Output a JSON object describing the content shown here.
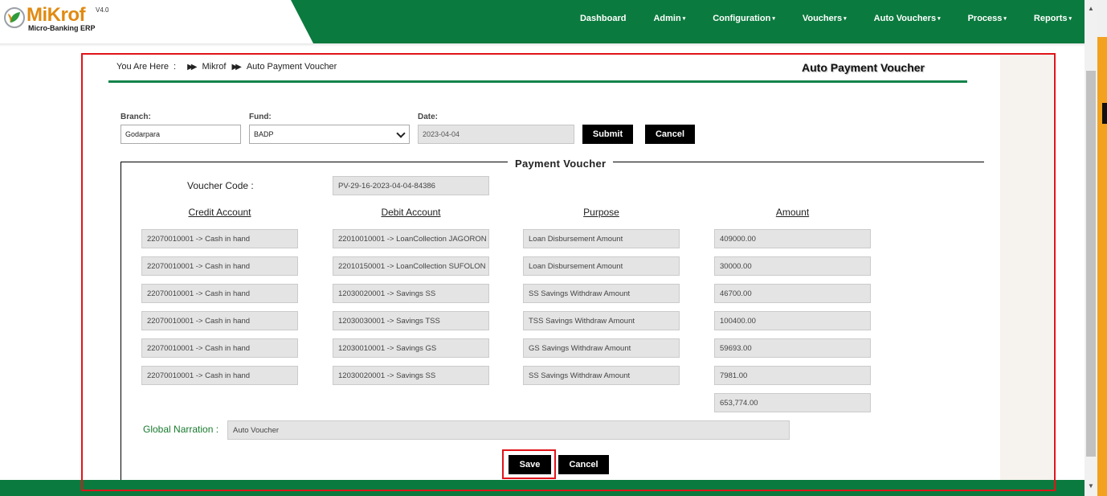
{
  "app": {
    "logo_name": "MiKrof",
    "logo_version": "V4.0",
    "logo_subtitle": "Micro-Banking ERP"
  },
  "nav": [
    {
      "label": "Dashboard",
      "dropdown": false
    },
    {
      "label": "Admin",
      "dropdown": true
    },
    {
      "label": "Configuration",
      "dropdown": true
    },
    {
      "label": "Vouchers",
      "dropdown": true
    },
    {
      "label": "Auto Vouchers",
      "dropdown": true
    },
    {
      "label": "Process",
      "dropdown": true
    },
    {
      "label": "Reports",
      "dropdown": true
    }
  ],
  "breadcrumb": {
    "prefix": "You Are Here",
    "colon": ":",
    "items": [
      "Mikrof",
      "Auto Payment Voucher"
    ]
  },
  "page_title": "Auto Payment Voucher",
  "filters": {
    "branch_label": "Branch:",
    "branch_value": "Godarpara",
    "fund_label": "Fund:",
    "fund_value": "BADP",
    "date_label": "Date:",
    "date_value": "2023-04-04",
    "submit_label": "Submit",
    "cancel_label": "Cancel"
  },
  "voucher": {
    "legend": "Payment Voucher",
    "code_label": "Voucher Code :",
    "code_value": "PV-29-16-2023-04-04-84386",
    "columns": [
      "Credit Account",
      "Debit Account",
      "Purpose",
      "Amount"
    ],
    "rows": [
      {
        "credit": "22070010001 -> Cash in hand",
        "debit": "22010010001  -> LoanCollection JAGORON",
        "purpose": "Loan Disbursement Amount",
        "amount": "409000.00"
      },
      {
        "credit": "22070010001 -> Cash in hand",
        "debit": "22010150001  -> LoanCollection SUFOLON",
        "purpose": "Loan Disbursement Amount",
        "amount": "30000.00"
      },
      {
        "credit": "22070010001 -> Cash in hand",
        "debit": "12030020001  -> Savings SS",
        "purpose": "SS Savings Withdraw Amount",
        "amount": "46700.00"
      },
      {
        "credit": "22070010001 -> Cash in hand",
        "debit": "12030030001  -> Savings TSS",
        "purpose": "TSS Savings Withdraw Amount",
        "amount": "100400.00"
      },
      {
        "credit": "22070010001 -> Cash in hand",
        "debit": "12030010001  -> Savings GS",
        "purpose": "GS Savings Withdraw Amount",
        "amount": "59693.00"
      },
      {
        "credit": "22070010001 -> Cash in hand",
        "debit": "12030020001  -> Savings SS",
        "purpose": "SS Savings Withdraw Amount",
        "amount": "7981.00"
      }
    ],
    "total": "653,774.00",
    "narration_label": "Global Narration :",
    "narration_value": "Auto Voucher",
    "save_label": "Save",
    "cancel_label": "Cancel"
  },
  "colors": {
    "brand_green": "#0b7a3e",
    "logo_orange": "#e08a12",
    "highlight_red": "#e0141a"
  }
}
